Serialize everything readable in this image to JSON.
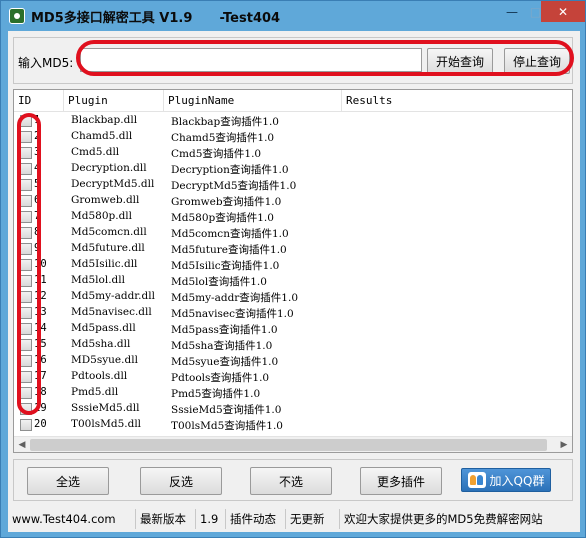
{
  "window": {
    "title": "MD5多接口解密工具 V1.9      -Test404",
    "minimize": "—",
    "maximize": "□",
    "close": "✕"
  },
  "md5": {
    "label": "输入MD5:",
    "value": "",
    "start_label": "开始查询",
    "stop_label": "停止查询"
  },
  "table": {
    "columns": [
      "ID",
      "Plugin",
      "PluginName",
      "Results"
    ],
    "rows": [
      {
        "id": "1",
        "plugin": "Blackbap.dll",
        "name": "Blackbap查询插件1.0"
      },
      {
        "id": "2",
        "plugin": "Chamd5.dll",
        "name": "Chamd5查询插件1.0"
      },
      {
        "id": "3",
        "plugin": "Cmd5.dll",
        "name": "Cmd5查询插件1.0"
      },
      {
        "id": "4",
        "plugin": "Decryption.dll",
        "name": "Decryption查询插件1.0"
      },
      {
        "id": "5",
        "plugin": "DecryptMd5.dll",
        "name": "DecryptMd5查询插件1.0"
      },
      {
        "id": "6",
        "plugin": "Gromweb.dll",
        "name": "Gromweb查询插件1.0"
      },
      {
        "id": "7",
        "plugin": "Md580p.dll",
        "name": "Md580p查询插件1.0"
      },
      {
        "id": "8",
        "plugin": "Md5comcn.dll",
        "name": "Md5comcn查询插件1.0"
      },
      {
        "id": "9",
        "plugin": "Md5future.dll",
        "name": "Md5future查询插件1.0"
      },
      {
        "id": "10",
        "plugin": "Md5Isilic.dll",
        "name": "Md5Isilic查询插件1.0"
      },
      {
        "id": "11",
        "plugin": "Md5lol.dll",
        "name": "Md5lol查询插件1.0"
      },
      {
        "id": "12",
        "plugin": "Md5my-addr.dll",
        "name": "Md5my-addr查询插件1.0"
      },
      {
        "id": "13",
        "plugin": "Md5navisec.dll",
        "name": "Md5navisec查询插件1.0"
      },
      {
        "id": "14",
        "plugin": "Md5pass.dll",
        "name": "Md5pass查询插件1.0"
      },
      {
        "id": "15",
        "plugin": "Md5sha.dll",
        "name": "Md5sha查询插件1.0"
      },
      {
        "id": "16",
        "plugin": "MD5syue.dll",
        "name": "Md5syue查询插件1.0"
      },
      {
        "id": "17",
        "plugin": "Pdtools.dll",
        "name": "Pdtools查询插件1.0"
      },
      {
        "id": "18",
        "plugin": "Pmd5.dll",
        "name": "Pmd5查询插件1.0"
      },
      {
        "id": "19",
        "plugin": "SssieMd5.dll",
        "name": "SssieMd5查询插件1.0"
      },
      {
        "id": "20",
        "plugin": "T00lsMd5.dll",
        "name": "T00lsMd5查询插件1.0"
      }
    ]
  },
  "buttons": {
    "select_all": "全选",
    "invert": "反选",
    "none": "不选",
    "more_plugins": "更多插件",
    "qq_group": "加入QQ群"
  },
  "status": {
    "site": "www.Test404.com",
    "latest_version_label": "最新版本",
    "version": "1.9",
    "plugin_news_label": "插件动态",
    "no_update": "无更新",
    "welcome": "欢迎大家提供更多的MD5免费解密网站"
  },
  "colors": {
    "titlebar": "#5fa8d9",
    "annotation_red": "#e0101e",
    "close_button": "#c5433a"
  }
}
